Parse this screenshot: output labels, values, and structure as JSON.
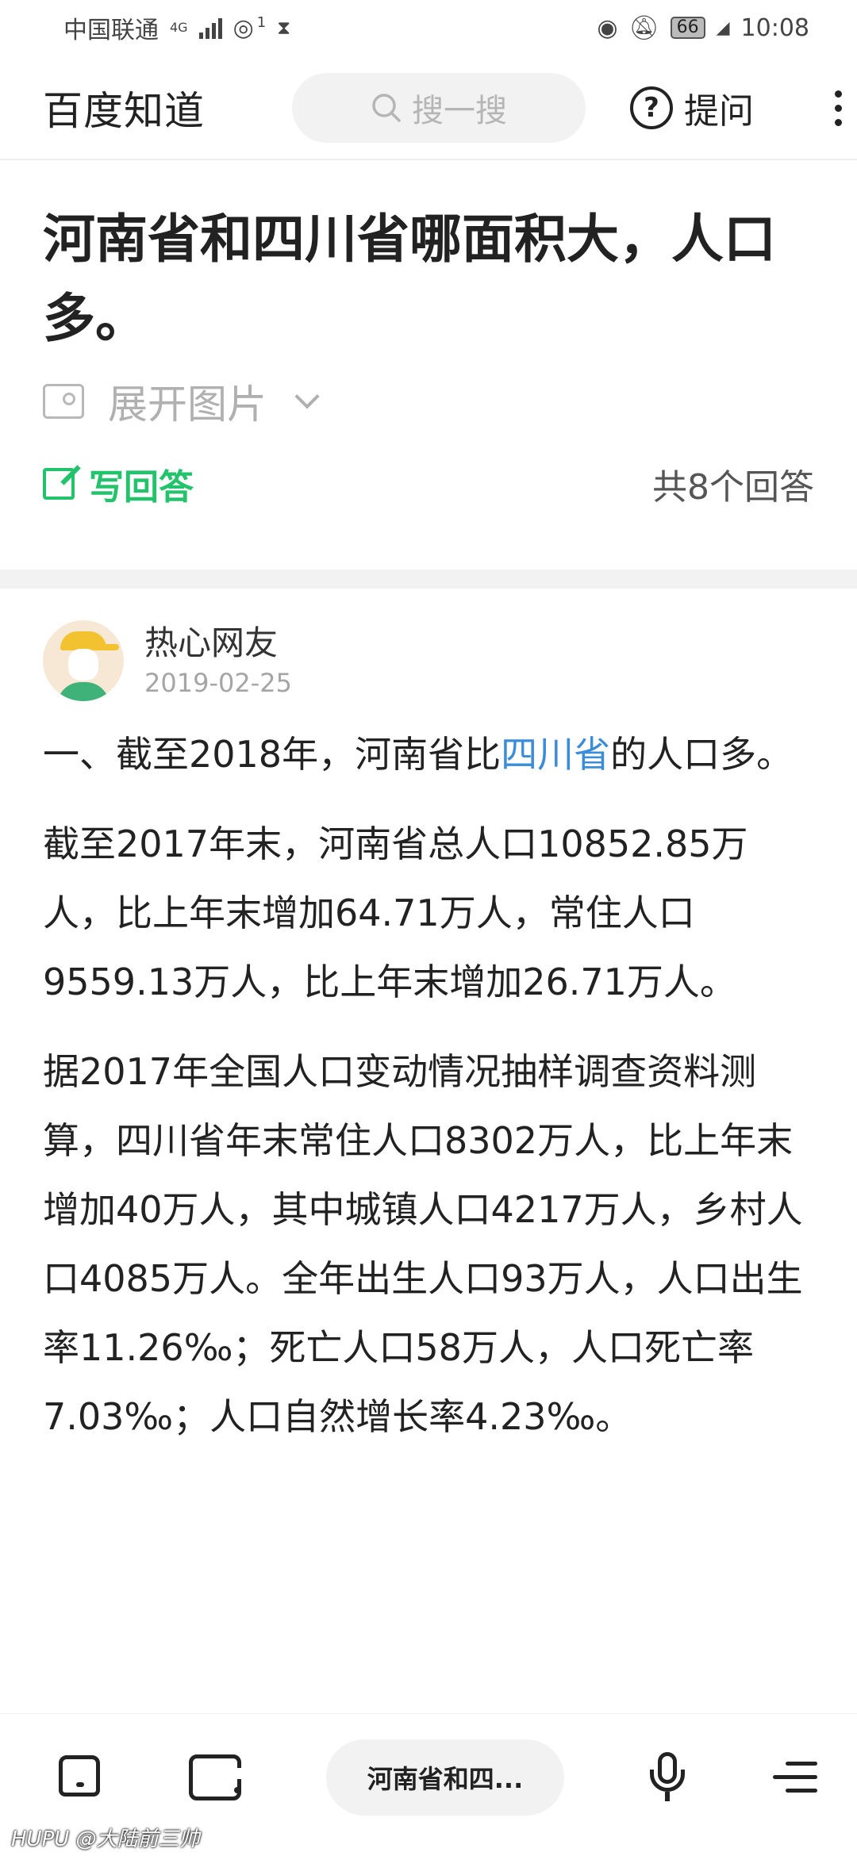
{
  "status_bar": {
    "carrier": "中国联通",
    "network": "4G",
    "sim_slot": "1",
    "battery": "66",
    "time": "10:08"
  },
  "app_bar": {
    "logo": "百度知道",
    "search_placeholder": "搜一搜",
    "ask_label": "提问"
  },
  "question": {
    "title": "河南省和四川省哪面积大，人口多。",
    "expand_images": "展开图片",
    "write_answer": "写回答",
    "answer_count": "共8个回答"
  },
  "answer": {
    "author": "热心网友",
    "date": "2019-02-25",
    "p1_before": "一、截至2018年，河南省比",
    "p1_link": "四川省",
    "p1_after": "的人口多。",
    "p2": "截至2017年末，河南省总人口10852.85万人，比上年末增加64.71万人，常住人口9559.13万人，比上年末增加26.71万人。",
    "p3": "据2017年全国人口变动情况抽样调查资料测算，四川省年末常住人口8302万人，比上年末增加40万人，其中城镇人口4217万人，乡村人口4085万人。全年出生人口93万人，人口出生率11.26‰；死亡人口58万人，人口死亡率7.03‰；人口自然增长率4.23‰。"
  },
  "bottom_nav": {
    "current_page": "河南省和四..."
  },
  "watermark": "HUPU @大陆前三帅",
  "colors": {
    "accent_green": "#23c36b",
    "link_blue": "#3b8cd9",
    "muted_gray": "#b0b0b0"
  },
  "icons": [
    "eye-icon",
    "bell-off-icon",
    "leaf-icon",
    "search-icon",
    "question-circle-icon",
    "more-vertical-icon",
    "image-icon",
    "chevron-down-icon",
    "edit-icon",
    "home-icon",
    "tabs-icon",
    "mic-icon",
    "menu-icon"
  ]
}
